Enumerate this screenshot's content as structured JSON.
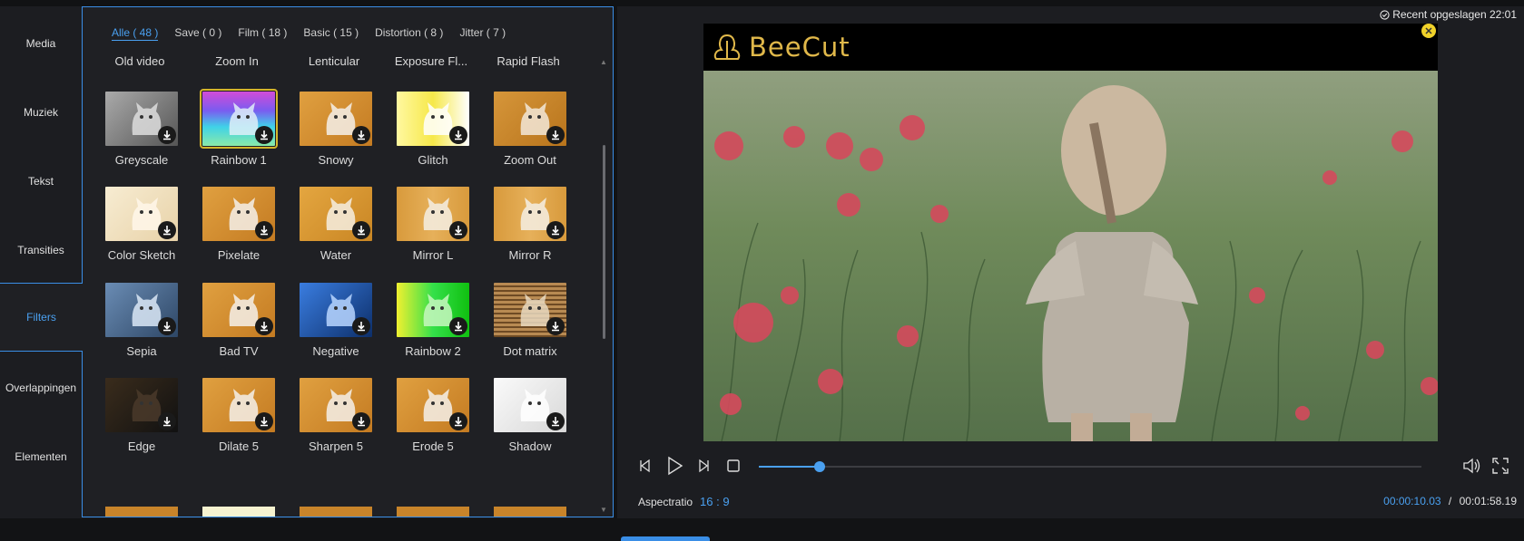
{
  "sidebar": {
    "items": [
      {
        "label": "Media"
      },
      {
        "label": "Muziek"
      },
      {
        "label": "Tekst"
      },
      {
        "label": "Transities"
      },
      {
        "label": "Filters",
        "active": true
      },
      {
        "label": "Overlappingen"
      },
      {
        "label": "Elementen"
      }
    ]
  },
  "filters": {
    "tabs": [
      {
        "label": "Alle ( 48 )",
        "active": true
      },
      {
        "label": "Save ( 0 )"
      },
      {
        "label": "Film ( 18 )"
      },
      {
        "label": "Basic ( 15 )"
      },
      {
        "label": "Distortion ( 8 )"
      },
      {
        "label": "Jitter ( 7 )"
      }
    ],
    "header_row": [
      "Old video",
      "Zoom In",
      "Lenticular",
      "Exposure Fl...",
      "Rapid Flash"
    ],
    "rows": [
      [
        {
          "name": "Greyscale",
          "style": "grey"
        },
        {
          "name": "Rainbow 1",
          "style": "rainbow",
          "selected": true
        },
        {
          "name": "Snowy",
          "style": "warm"
        },
        {
          "name": "Glitch",
          "style": "glitch"
        },
        {
          "name": "Zoom Out",
          "style": "zoomout"
        }
      ],
      [
        {
          "name": "Color Sketch",
          "style": "sketch"
        },
        {
          "name": "Pixelate",
          "style": "warm"
        },
        {
          "name": "Water",
          "style": "water"
        },
        {
          "name": "Mirror L",
          "style": "mirror"
        },
        {
          "name": "Mirror R",
          "style": "mirror"
        }
      ],
      [
        {
          "name": "Sepia",
          "style": "bluegrey"
        },
        {
          "name": "Bad TV",
          "style": "warm"
        },
        {
          "name": "Negative",
          "style": "negative"
        },
        {
          "name": "Rainbow 2",
          "style": "rainbow2"
        },
        {
          "name": "Dot matrix",
          "style": "dotmatrix"
        }
      ],
      [
        {
          "name": "Edge",
          "style": "edge"
        },
        {
          "name": "Dilate 5",
          "style": "warm"
        },
        {
          "name": "Sharpen 5",
          "style": "warm"
        },
        {
          "name": "Erode 5",
          "style": "warm"
        },
        {
          "name": "Shadow",
          "style": "shadow"
        }
      ]
    ]
  },
  "preview": {
    "saved_text": "Recent opgeslagen 22:01",
    "brand": "BeeCut",
    "close_glyph": "✕",
    "progress": 0.092,
    "aspect_label": "Aspectratio",
    "aspect_value": "16 : 9",
    "time_current": "00:00:10.03",
    "time_separator": "/",
    "time_total": "00:01:58.19"
  },
  "colors": {
    "accent": "#4aa0f0",
    "selected_outline": "#d4b52a",
    "brand_gold": "#e0b84a"
  }
}
